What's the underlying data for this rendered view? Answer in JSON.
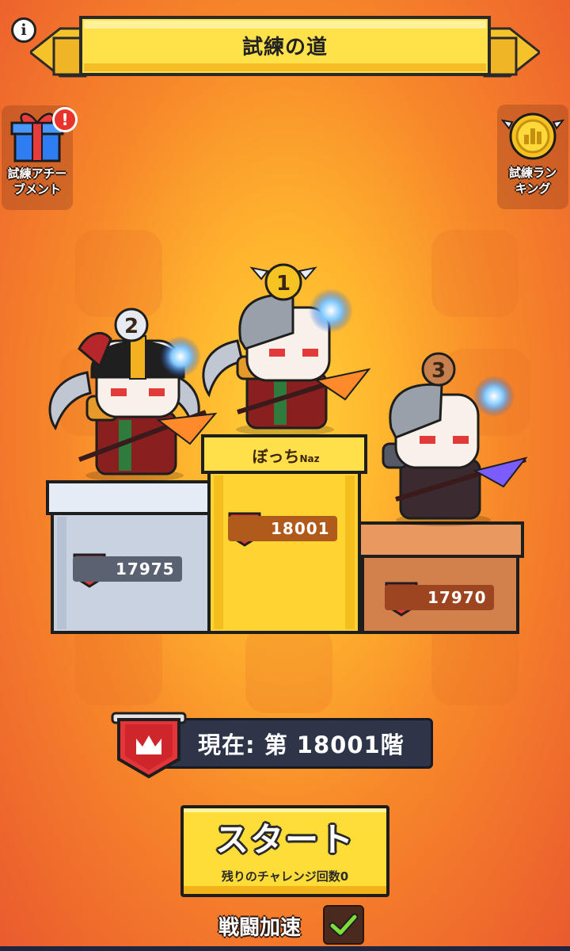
{
  "header": {
    "title": "試練の道",
    "info_icon": "i"
  },
  "side": {
    "achievement": {
      "label_line1": "試練アチー",
      "label_line2": "ブメント",
      "alert": "!"
    },
    "ranking": {
      "label_line1": "試練ラン",
      "label_line2": "キング"
    }
  },
  "podium": {
    "first": {
      "rank": "1",
      "name": "ぼっち",
      "name_suffix": "Naz",
      "score": "18001"
    },
    "second": {
      "rank": "2",
      "score": "17975"
    },
    "third": {
      "rank": "3",
      "score": "17970"
    }
  },
  "current": {
    "text": "現在: 第 18001階"
  },
  "start": {
    "label": "スタート",
    "sub": "残りのチャレンジ回数0"
  },
  "speed": {
    "label": "戦闘加速",
    "enabled": true
  },
  "colors": {
    "gold": "#ffdd38",
    "silver": "#c9d3e2",
    "bronze": "#d2814c",
    "accent_red": "#e4353a"
  }
}
